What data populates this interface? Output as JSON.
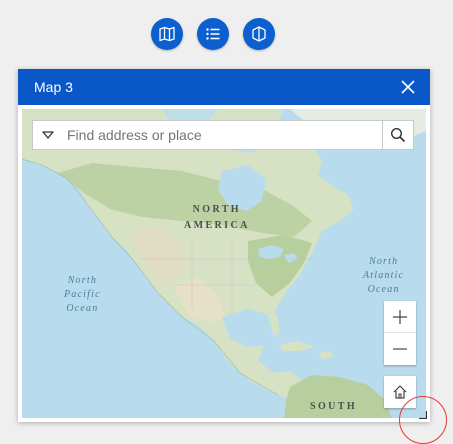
{
  "toolbar": {
    "buttons": [
      {
        "name": "map-icon"
      },
      {
        "name": "list-icon"
      },
      {
        "name": "3d-icon"
      }
    ]
  },
  "panel": {
    "title": "Map 3",
    "close_icon": "close-icon"
  },
  "search": {
    "placeholder": "Find address or place",
    "value": "",
    "dropdown_icon": "chevron-down-icon",
    "search_icon": "search-icon"
  },
  "map": {
    "labels": {
      "north_america": [
        "NORTH",
        "AMERICA"
      ],
      "north_pacific": [
        "North",
        "Pacific",
        "Ocean"
      ],
      "north_atlantic": [
        "North",
        "Atlantic",
        "Ocean"
      ],
      "south": "SOUTH"
    },
    "controls": {
      "zoom_in_icon": "plus-icon",
      "zoom_out_icon": "minus-icon",
      "home_icon": "home-icon"
    }
  },
  "colors": {
    "accent": "#0a57c7",
    "button": "#0b5fcf",
    "ocean": "#b8dced",
    "highlight": "#e53935"
  }
}
